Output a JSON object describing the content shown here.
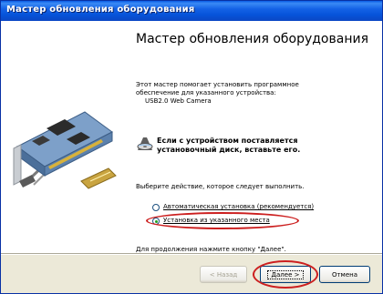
{
  "window": {
    "title": "Мастер обновления оборудования"
  },
  "wizard": {
    "heading": "Мастер обновления оборудования",
    "intro_line1": "Этот мастер помогает установить программное",
    "intro_line2": "обеспечение для указанного устройства:",
    "device_name": "USB2.0 Web Camera",
    "cd_text_line1": "Если с устройством поставляется",
    "cd_text_line2": "установочный диск, вставьте его.",
    "prompt": "Выберите действие, которое следует выполнить.",
    "options": [
      {
        "label": "Автоматическая установка (рекомендуется)",
        "selected": false
      },
      {
        "label": "Установка из указанного места",
        "selected": true
      }
    ],
    "footnote": "Для продолжения нажмите кнопку \"Далее\"."
  },
  "buttons": {
    "back": "< Назад",
    "next": "Далее >",
    "cancel": "Отмена"
  },
  "colors": {
    "titlebar": "#0a5ce5",
    "highlight": "#cc1f1f"
  },
  "icons": {
    "wizard_graphic": "hardware-card-icon",
    "cd": "cd-disc-icon"
  }
}
